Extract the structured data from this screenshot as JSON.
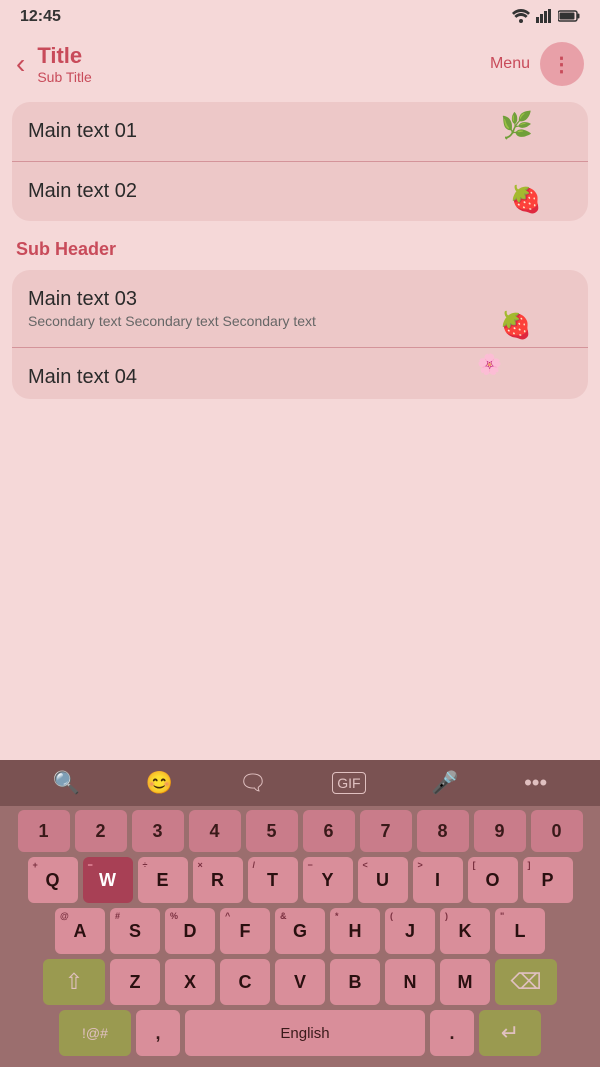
{
  "statusBar": {
    "time": "12:45",
    "icons": "📶 📶 🔋"
  },
  "header": {
    "back": "‹",
    "title": "Title",
    "subtitle": "Sub Title",
    "menuLabel": "Menu"
  },
  "list1": [
    {
      "main": "Main text 01",
      "deco": "🌿",
      "decoStyle": "top:8px;right:60px;"
    },
    {
      "main": "Main text 02",
      "deco": "🍓",
      "decoStyle": "bottom:8px;right:50px;"
    }
  ],
  "subHeader": "Sub Header",
  "list2": [
    {
      "main": "Main text 03",
      "secondary": "Secondary text Secondary text Secondary text",
      "deco": "🍓",
      "decoStyle": "bottom:8px;right:60px;"
    },
    {
      "main": "Main text 04",
      "deco": "🌸",
      "decoStyle": "top:6px;right:90px;"
    }
  ],
  "keyboard": {
    "toolbar": [
      "🔍",
      "😊",
      "🗨",
      "GIF",
      "🎤",
      "···"
    ],
    "numbers": [
      "1",
      "2",
      "3",
      "4",
      "5",
      "6",
      "7",
      "8",
      "9",
      "0"
    ],
    "row1": [
      "Q",
      "W",
      "E",
      "R",
      "T",
      "Y",
      "U",
      "I",
      "O",
      "P"
    ],
    "row1sub": [
      null,
      null,
      null,
      null,
      null,
      null,
      null,
      null,
      null,
      null
    ],
    "row2": [
      "A",
      "S",
      "D",
      "F",
      "G",
      "H",
      "J",
      "K",
      "L"
    ],
    "row3": [
      "Z",
      "X",
      "C",
      "V",
      "B",
      "N",
      "M"
    ],
    "spacebar": "English",
    "symbols": "!@#",
    "activeKey": "W"
  }
}
